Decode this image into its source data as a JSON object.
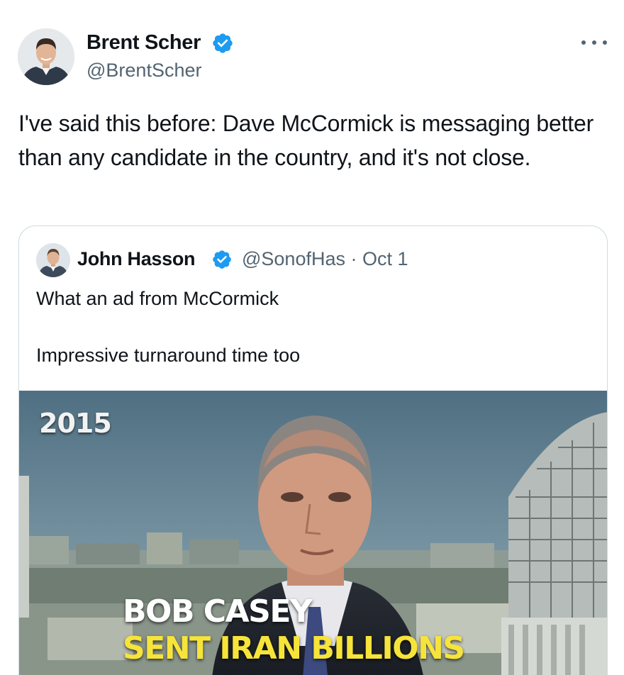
{
  "tweet": {
    "author": {
      "name": "Brent Scher",
      "handle": "@BrentScher",
      "avatar_icon": "profile-photo"
    },
    "verified_icon": "verified-badge-icon",
    "more_icon": "more-options-icon",
    "text": "I've said this before: Dave McCormick is messaging better than any candidate in the country, and it's not close."
  },
  "quote": {
    "author": {
      "name": "John Hasson",
      "handle_date": "@SonofHas · Oct 1",
      "avatar_icon": "profile-photo"
    },
    "text_line1": "What an ad from McCormick",
    "text_line2": "Impressive turnaround time too",
    "video": {
      "year_label": "2015",
      "caption_line1": "BOB CASEY",
      "caption_line2": "SENT IRAN BILLIONS"
    }
  },
  "colors": {
    "verified_blue": "#1d9bf0",
    "secondary_text": "#536471",
    "border": "#cfd9de",
    "caption_yellow": "#f7e43a"
  }
}
